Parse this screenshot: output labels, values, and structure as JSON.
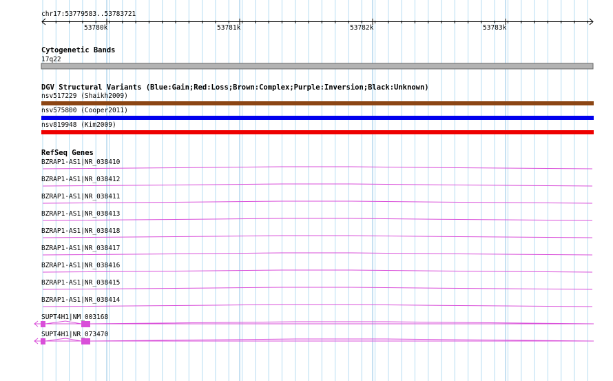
{
  "ruler": {
    "location": "chr17:53779583..53783721",
    "ticks": [
      {
        "label": "53780k",
        "pos": 53780000
      },
      {
        "label": "53781k",
        "pos": 53781000
      },
      {
        "label": "53782k",
        "pos": 53782000
      },
      {
        "label": "53783k",
        "pos": 53783000
      }
    ]
  },
  "cytoband": {
    "title": "Cytogenetic Bands",
    "band": "17q22",
    "color": "#b3b3b3"
  },
  "dgv": {
    "title": "DGV Structural Variants (Blue:Gain;Red:Loss;Brown:Complex;Purple:Inversion;Black:Unknown)",
    "variants": [
      {
        "label": "nsv517229 (Shaikh2009)",
        "color": "#8b4513"
      },
      {
        "label": "nsv575800 (Cooper2011)",
        "color": "#0000ee"
      },
      {
        "label": "nsv819948 (Kim2009)",
        "color": "#ee0000"
      }
    ]
  },
  "refseq": {
    "title": "RefSeq Genes",
    "color": "#d94fd9",
    "genes": [
      {
        "label": "BZRAP1-AS1|NR_038410"
      },
      {
        "label": "BZRAP1-AS1|NR_038412"
      },
      {
        "label": "BZRAP1-AS1|NR_038411"
      },
      {
        "label": "BZRAP1-AS1|NR_038413"
      },
      {
        "label": "BZRAP1-AS1|NR_038418"
      },
      {
        "label": "BZRAP1-AS1|NR_038417"
      },
      {
        "label": "BZRAP1-AS1|NR_038416"
      },
      {
        "label": "BZRAP1-AS1|NR_038415"
      },
      {
        "label": "BZRAP1-AS1|NR_038414"
      },
      {
        "label": "SUPT4H1|NM_003168"
      },
      {
        "label": "SUPT4H1|NR_073470"
      }
    ]
  }
}
